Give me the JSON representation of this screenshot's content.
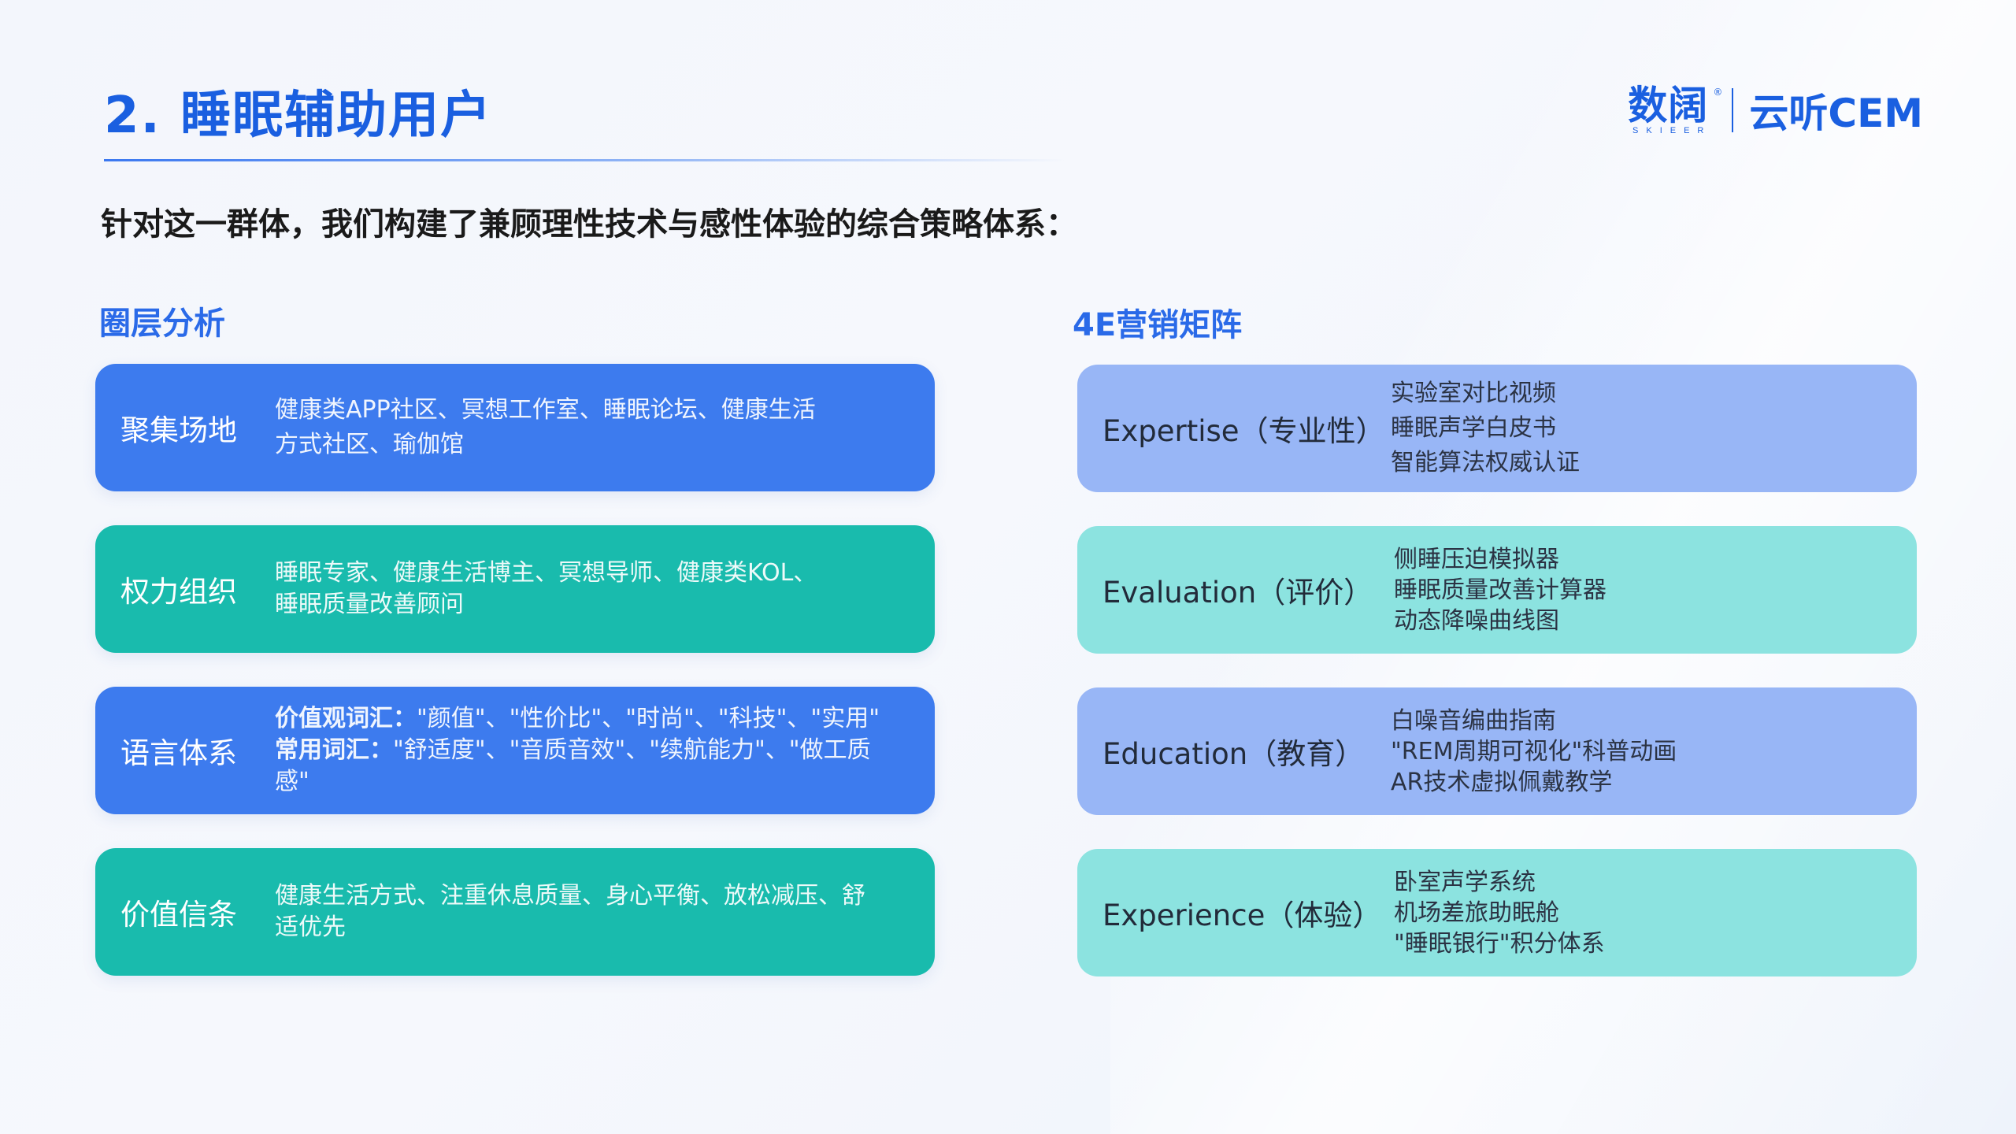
{
  "title": "2. 睡眠辅助用户",
  "logo": {
    "brand": "数阔",
    "brand_sub": "SKIEER",
    "registered": "®",
    "product": "云听CEM"
  },
  "intro": "针对这一群体，我们构建了兼顾理性技术与感性体验的综合策略体系：",
  "left_section": {
    "title": "圈层分析",
    "cards": [
      {
        "label": "聚集场地",
        "lines": [
          "健康类APP社区、冥想工作室、睡眠论坛、健康生活",
          "方式社区、瑜伽馆"
        ]
      },
      {
        "label": "权力组织",
        "lines": [
          "睡眠专家、健康生活博主、冥想导师、健康类KOL、",
          "睡眠质量改善顾问"
        ]
      },
      {
        "label": "语言体系",
        "bold1": "价值观词汇：",
        "text1": "\"颜值\"、\"性价比\"、\"时尚\"、\"科技\"、\"实用\"",
        "bold2": "常用词汇：",
        "text2": "\"舒适度\"、\"音质音效\"、\"续航能力\"、\"做工质",
        "text3": "感\""
      },
      {
        "label": "价值信条",
        "lines": [
          "健康生活方式、注重休息质量、身心平衡、放松减压、舒",
          "适优先"
        ]
      }
    ]
  },
  "right_section": {
    "title": "4E营销矩阵",
    "cards": [
      {
        "label": "Expertise（专业性）",
        "items": [
          "实验室对比视频",
          "睡眠声学白皮书",
          "智能算法权威认证"
        ]
      },
      {
        "label": "Evaluation（评价）",
        "items": [
          "侧睡压迫模拟器",
          "睡眠质量改善计算器",
          "动态降噪曲线图"
        ]
      },
      {
        "label": "Education（教育）",
        "items": [
          "白噪音编曲指南",
          "\"REM周期可视化\"科普动画",
          "AR技术虚拟佩戴教学"
        ]
      },
      {
        "label": "Experience（体验）",
        "items": [
          "卧室声学系统",
          "机场差旅助眠舱",
          "\"睡眠银行\"积分体系"
        ]
      }
    ]
  },
  "colors": {
    "accent": "#1a5fe0",
    "card_blue": "#3d7bee",
    "card_teal": "#19bbad",
    "card_light_blue": "#98b6f6",
    "card_light_teal": "#8ce3e0"
  }
}
